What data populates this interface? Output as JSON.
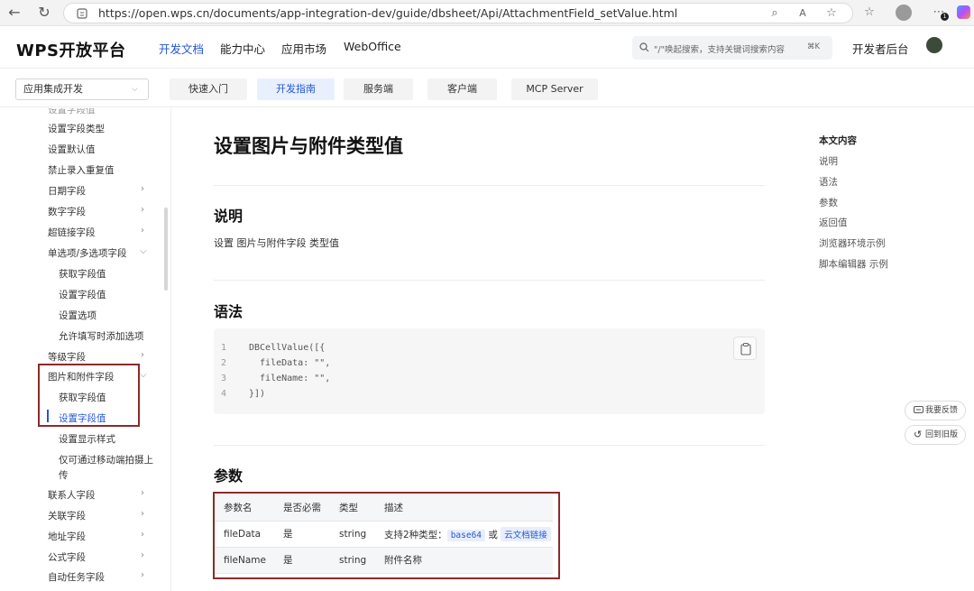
{
  "browser": {
    "url": "https://open.wps.cn/documents/app-integration-dev/guide/dbsheet/Api/AttachmentField_setValue.html",
    "extensions_badge": "1"
  },
  "header": {
    "logo": "WPS开放平台",
    "nav": [
      "开发文档",
      "能力中心",
      "应用市场",
      "WebOffice"
    ],
    "search_placeholder": "\"/\"唤起搜索，支持关键词搜索内容",
    "search_shortcut": "⌘K",
    "console": "开发者后台"
  },
  "subnav": {
    "select_value": "应用集成开发",
    "tabs": [
      "快速入门",
      "开发指南",
      "服务端",
      "客户端",
      "MCP Server"
    ]
  },
  "sidebar": {
    "items": [
      "设置字段类型",
      "设置默认值",
      "禁止录入重复值",
      "日期字段",
      "数字字段",
      "超链接字段",
      "单选项/多选项字段",
      "获取字段值",
      "设置字段值",
      "设置选项",
      "允许填写时添加选项",
      "等级字段",
      "图片和附件字段",
      "获取字段值",
      "设置字段值",
      "设置显示样式",
      "仅可通过移动端拍摄上",
      "传",
      "联系人字段",
      "关联字段",
      "地址字段",
      "公式字段",
      "自动任务字段"
    ],
    "top_partial": "设置字段值"
  },
  "article": {
    "title": "设置图片与附件类型值",
    "sections": {
      "desc_title": "说明",
      "desc_text": "设置 图片与附件字段 类型值",
      "syntax_title": "语法",
      "params_title": "参数"
    },
    "code": {
      "line_numbers": [
        "1",
        "2",
        "3",
        "4"
      ],
      "lines": [
        "DBCellValue([{",
        "  fileData: \"\",",
        "  fileName: \"\",",
        "}])"
      ]
    },
    "params": {
      "headers": [
        "参数名",
        "是否必需",
        "类型",
        "描述"
      ],
      "rows": [
        {
          "name": "fileData",
          "required": "是",
          "type": "string",
          "desc_prefix": "支持2种类型：",
          "tag1": "base64",
          "or": "或",
          "tag2": "云文档链接"
        },
        {
          "name": "fileName",
          "required": "是",
          "type": "string",
          "desc": "附件名称"
        }
      ]
    }
  },
  "toc": {
    "title": "本文内容",
    "items": [
      "说明",
      "语法",
      "参数",
      "返回值",
      "浏览器环境示例",
      "脚本编辑器 示例"
    ]
  },
  "floating": {
    "feedback": "我要反馈",
    "old_version": "回到旧版"
  },
  "colors": {
    "accent": "#2456d4",
    "highlight_box": "#8b2a2a"
  }
}
